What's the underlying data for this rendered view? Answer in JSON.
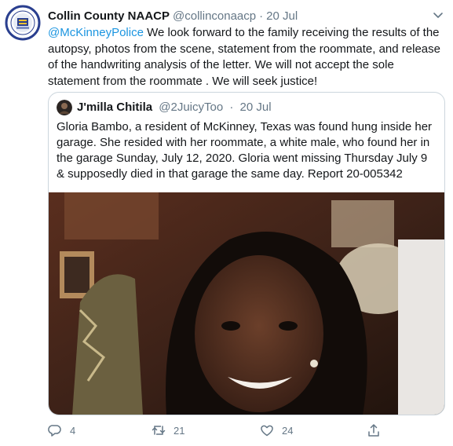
{
  "tweet": {
    "author_name": "Collin County NAACP",
    "handle": "@collinconaacp",
    "separator": "·",
    "date": "20 Jul",
    "mention": "@McKinneyPolice",
    "text": " We look forward to the family receiving the results of the autopsy, photos from the scene, statement from the roommate, and release of the handwriting analysis of the letter. We will not accept the sole statement from the roommate . We will seek justice!",
    "avatar_icon": "naacp-seal-icon"
  },
  "quoted": {
    "author_name": "J'milla Chitila",
    "handle": "@2JuicyToo",
    "separator": "·",
    "date": "20 Jul",
    "text": "Gloria Bambo, a resident of McKinney, Texas was found hung inside her garage. She resided with her roommate, a white male, who found her in the garage Sunday, July 12, 2020. Gloria went missing Thursday July 9 & supposedly died in that garage the same day.  Report 20-005342"
  },
  "actions": {
    "reply_count": "4",
    "retweet_count": "21",
    "like_count": "24",
    "icons": [
      "reply-icon",
      "retweet-icon",
      "like-icon",
      "share-icon"
    ]
  },
  "colors": {
    "link": "#1b95e0",
    "secondary_text": "#657786",
    "primary_text": "#14171a",
    "border": "#ccd6dd"
  }
}
